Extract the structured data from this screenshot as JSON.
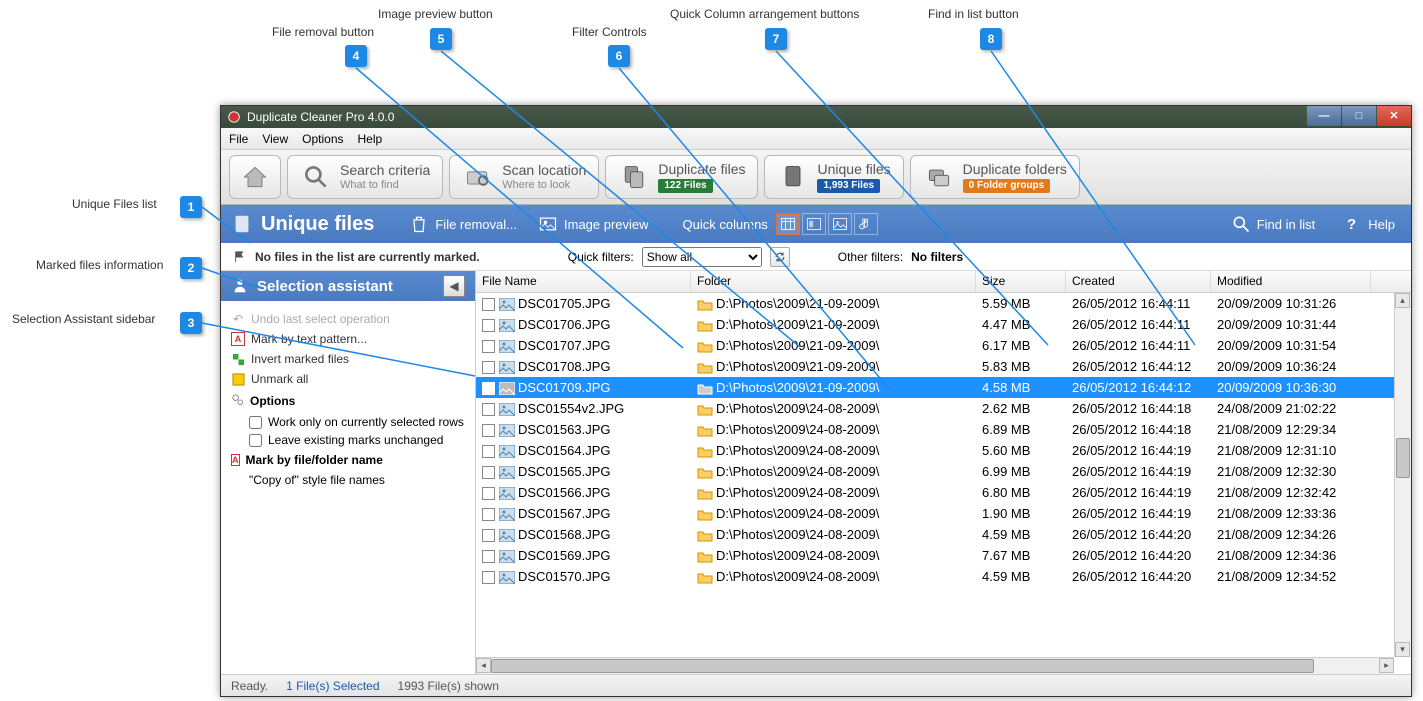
{
  "callouts": {
    "c1": {
      "label": "Unique Files list"
    },
    "c2": {
      "label": "Marked files information"
    },
    "c3": {
      "label": "Selection Assistant sidebar"
    },
    "c4": {
      "label": "File removal button"
    },
    "c5": {
      "label": "Image preview button"
    },
    "c6": {
      "label": "Filter Controls"
    },
    "c7": {
      "label": "Quick Column arrangement buttons"
    },
    "c8": {
      "label": "Find in list button"
    }
  },
  "window": {
    "title": "Duplicate Cleaner Pro 4.0.0"
  },
  "menu": {
    "file": "File",
    "view": "View",
    "options": "Options",
    "help": "Help"
  },
  "tabs": {
    "home": {
      "title": ""
    },
    "search": {
      "title": "Search criteria",
      "sub": "What to find"
    },
    "scan": {
      "title": "Scan location",
      "sub": "Where to look"
    },
    "dup": {
      "title": "Duplicate files",
      "badge": "122 Files"
    },
    "unique": {
      "title": "Unique files",
      "badge": "1,993 Files"
    },
    "folders": {
      "title": "Duplicate folders",
      "badge": "0 Folder groups"
    }
  },
  "actionbar": {
    "title": "Unique files",
    "file_removal": "File removal...",
    "image_preview": "Image preview",
    "quick_columns": "Quick columns",
    "find_in_list": "Find in list",
    "help": "Help"
  },
  "filters": {
    "marked_info": "No files in the list are currently marked.",
    "qf_label": "Quick filters:",
    "qf_value": "Show all",
    "of_label": "Other filters:",
    "of_value": "No filters"
  },
  "sidebar": {
    "title": "Selection assistant",
    "undo": "Undo last select operation",
    "mark_text": "Mark by text pattern...",
    "invert": "Invert marked files",
    "unmark": "Unmark all",
    "options": "Options",
    "opt1": "Work only on currently selected rows",
    "opt2": "Leave existing marks unchanged",
    "mark_ff": "Mark by file/folder name",
    "copy_of": "\"Copy of\" style file names"
  },
  "columns": {
    "name": "File Name",
    "folder": "Folder",
    "size": "Size",
    "created": "Created",
    "modified": "Modified"
  },
  "rows": [
    {
      "name": "DSC01705.JPG",
      "folder": "D:\\Photos\\2009\\21-09-2009\\",
      "size": "5.59 MB",
      "created": "26/05/2012 16:44:11",
      "modified": "20/09/2009 10:31:26",
      "selected": false
    },
    {
      "name": "DSC01706.JPG",
      "folder": "D:\\Photos\\2009\\21-09-2009\\",
      "size": "4.47 MB",
      "created": "26/05/2012 16:44:11",
      "modified": "20/09/2009 10:31:44",
      "selected": false
    },
    {
      "name": "DSC01707.JPG",
      "folder": "D:\\Photos\\2009\\21-09-2009\\",
      "size": "6.17 MB",
      "created": "26/05/2012 16:44:11",
      "modified": "20/09/2009 10:31:54",
      "selected": false
    },
    {
      "name": "DSC01708.JPG",
      "folder": "D:\\Photos\\2009\\21-09-2009\\",
      "size": "5.83 MB",
      "created": "26/05/2012 16:44:12",
      "modified": "20/09/2009 10:36:24",
      "selected": false
    },
    {
      "name": "DSC01709.JPG",
      "folder": "D:\\Photos\\2009\\21-09-2009\\",
      "size": "4.58 MB",
      "created": "26/05/2012 16:44:12",
      "modified": "20/09/2009 10:36:30",
      "selected": true
    },
    {
      "name": "DSC01554v2.JPG",
      "folder": "D:\\Photos\\2009\\24-08-2009\\",
      "size": "2.62 MB",
      "created": "26/05/2012 16:44:18",
      "modified": "24/08/2009 21:02:22",
      "selected": false
    },
    {
      "name": "DSC01563.JPG",
      "folder": "D:\\Photos\\2009\\24-08-2009\\",
      "size": "6.89 MB",
      "created": "26/05/2012 16:44:18",
      "modified": "21/08/2009 12:29:34",
      "selected": false
    },
    {
      "name": "DSC01564.JPG",
      "folder": "D:\\Photos\\2009\\24-08-2009\\",
      "size": "5.60 MB",
      "created": "26/05/2012 16:44:19",
      "modified": "21/08/2009 12:31:10",
      "selected": false
    },
    {
      "name": "DSC01565.JPG",
      "folder": "D:\\Photos\\2009\\24-08-2009\\",
      "size": "6.99 MB",
      "created": "26/05/2012 16:44:19",
      "modified": "21/08/2009 12:32:30",
      "selected": false
    },
    {
      "name": "DSC01566.JPG",
      "folder": "D:\\Photos\\2009\\24-08-2009\\",
      "size": "6.80 MB",
      "created": "26/05/2012 16:44:19",
      "modified": "21/08/2009 12:32:42",
      "selected": false
    },
    {
      "name": "DSC01567.JPG",
      "folder": "D:\\Photos\\2009\\24-08-2009\\",
      "size": "1.90 MB",
      "created": "26/05/2012 16:44:19",
      "modified": "21/08/2009 12:33:36",
      "selected": false
    },
    {
      "name": "DSC01568.JPG",
      "folder": "D:\\Photos\\2009\\24-08-2009\\",
      "size": "4.59 MB",
      "created": "26/05/2012 16:44:20",
      "modified": "21/08/2009 12:34:26",
      "selected": false
    },
    {
      "name": "DSC01569.JPG",
      "folder": "D:\\Photos\\2009\\24-08-2009\\",
      "size": "7.67 MB",
      "created": "26/05/2012 16:44:20",
      "modified": "21/08/2009 12:34:36",
      "selected": false
    },
    {
      "name": "DSC01570.JPG",
      "folder": "D:\\Photos\\2009\\24-08-2009\\",
      "size": "4.59 MB",
      "created": "26/05/2012 16:44:20",
      "modified": "21/08/2009 12:34:52",
      "selected": false
    }
  ],
  "status": {
    "ready": "Ready.",
    "selected": "1 File(s) Selected",
    "shown": "1993 File(s) shown"
  }
}
